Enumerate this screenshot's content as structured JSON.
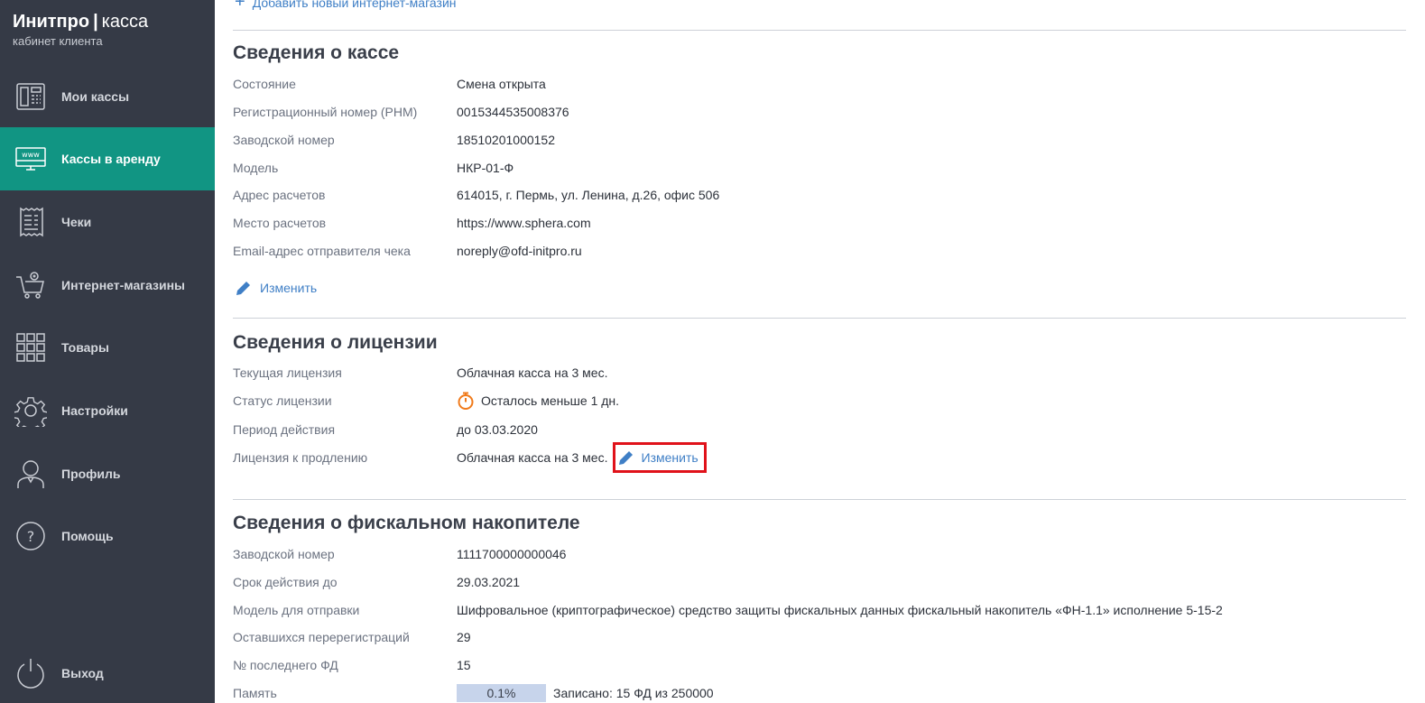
{
  "brand": {
    "name": "Инитпро",
    "separator": "|",
    "suffix": "касса",
    "subtitle": "кабинет клиента"
  },
  "sidebar": {
    "items": [
      {
        "label": "Мои кассы",
        "icon": "cash-register-icon"
      },
      {
        "label": "Кассы в аренду",
        "icon": "www-monitor-icon",
        "active": true
      },
      {
        "label": "Чеки",
        "icon": "receipt-icon"
      },
      {
        "label": "Интернет-магазины",
        "icon": "shopping-cart-icon"
      },
      {
        "label": "Товары",
        "icon": "grid-icon"
      },
      {
        "label": "Настройки",
        "icon": "gear-icon"
      },
      {
        "label": "Профиль",
        "icon": "user-icon"
      },
      {
        "label": "Помощь",
        "icon": "help-icon"
      }
    ],
    "logout": {
      "label": "Выход",
      "icon": "power-icon"
    }
  },
  "main": {
    "add_shop_label": "Добавить новый интернет-магазин",
    "kassa": {
      "title": "Сведения о кассе",
      "rows": [
        {
          "label": "Состояние",
          "value": "Смена открыта"
        },
        {
          "label": "Регистрационный номер (РНМ)",
          "value": "0015344535008376"
        },
        {
          "label": "Заводской номер",
          "value": "18510201000152"
        },
        {
          "label": "Модель",
          "value": "НКР-01-Ф"
        },
        {
          "label": "Адрес расчетов",
          "value": "614015, г. Пермь, ул. Ленина, д.26, офис 506"
        },
        {
          "label": "Место расчетов",
          "value": "https://www.sphera.com"
        },
        {
          "label": "Email-адрес отправителя чека",
          "value": "noreply@ofd-initpro.ru"
        }
      ],
      "edit_label": "Изменить"
    },
    "license": {
      "title": "Сведения о лицензии",
      "rows": [
        {
          "label": "Текущая лицензия",
          "value": "Облачная касса на 3 мес."
        },
        {
          "label": "Статус лицензии",
          "value": "Осталось меньше 1 дн."
        },
        {
          "label": "Период действия",
          "value": "до 03.03.2020"
        },
        {
          "label": "Лицензия к продлению",
          "value": "Облачная касса на 3 мес."
        }
      ],
      "edit_label": "Изменить"
    },
    "fn": {
      "title": "Сведения о фискальном накопителе",
      "rows": [
        {
          "label": "Заводской номер",
          "value": "1111700000000046"
        },
        {
          "label": "Срок действия до",
          "value": "29.03.2021"
        },
        {
          "label": "Модель для отправки",
          "value": "Шифровальное (криптографическое) средство защиты фискальных данных фискальный накопитель «ФН-1.1» исполнение 5-15-2"
        },
        {
          "label": "Оставшихся перерегистраций",
          "value": "29"
        },
        {
          "label": "№ последнего ФД",
          "value": "15"
        },
        {
          "label": "Память",
          "value": "0.1%"
        }
      ],
      "memory_fraction": 0.001,
      "memory_text": "Записано: 15 ФД из 250000"
    }
  },
  "colors": {
    "sidebar_bg": "#353a46",
    "active_item": "#119583",
    "link": "#3f7fc6",
    "highlight_border": "#e0121a",
    "timer": "#f07a1a",
    "memory_bar": "#c7d4eb"
  }
}
